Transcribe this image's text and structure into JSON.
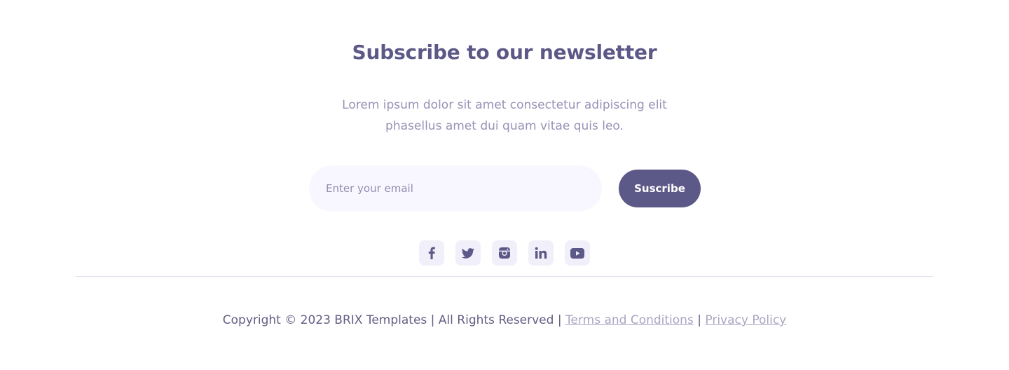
{
  "newsletter": {
    "title": "Subscribe to our newsletter",
    "description_line1": "Lorem ipsum dolor sit amet consectetur adipiscing elit",
    "description_line2": "phasellus amet dui quam vitae quis leo.",
    "email_placeholder": "Enter your email",
    "email_value": "",
    "subscribe_label": "Suscribe"
  },
  "social": {
    "icons": [
      "facebook-icon",
      "twitter-icon",
      "instagram-icon",
      "linkedin-icon",
      "youtube-icon"
    ]
  },
  "footer": {
    "copyright": "Copyright © 2023 BRIX Templates | All Rights Reserved |",
    "terms_link": "Terms and Conditions",
    "separator": "|",
    "privacy_link": "Privacy Policy"
  },
  "colors": {
    "primary": "#5c5887",
    "muted_text": "#9692b6",
    "link": "#a8a5c2",
    "input_bg": "#f8f7ff",
    "icon_bg": "#f1f0fa",
    "divider": "#e2e1eb"
  }
}
